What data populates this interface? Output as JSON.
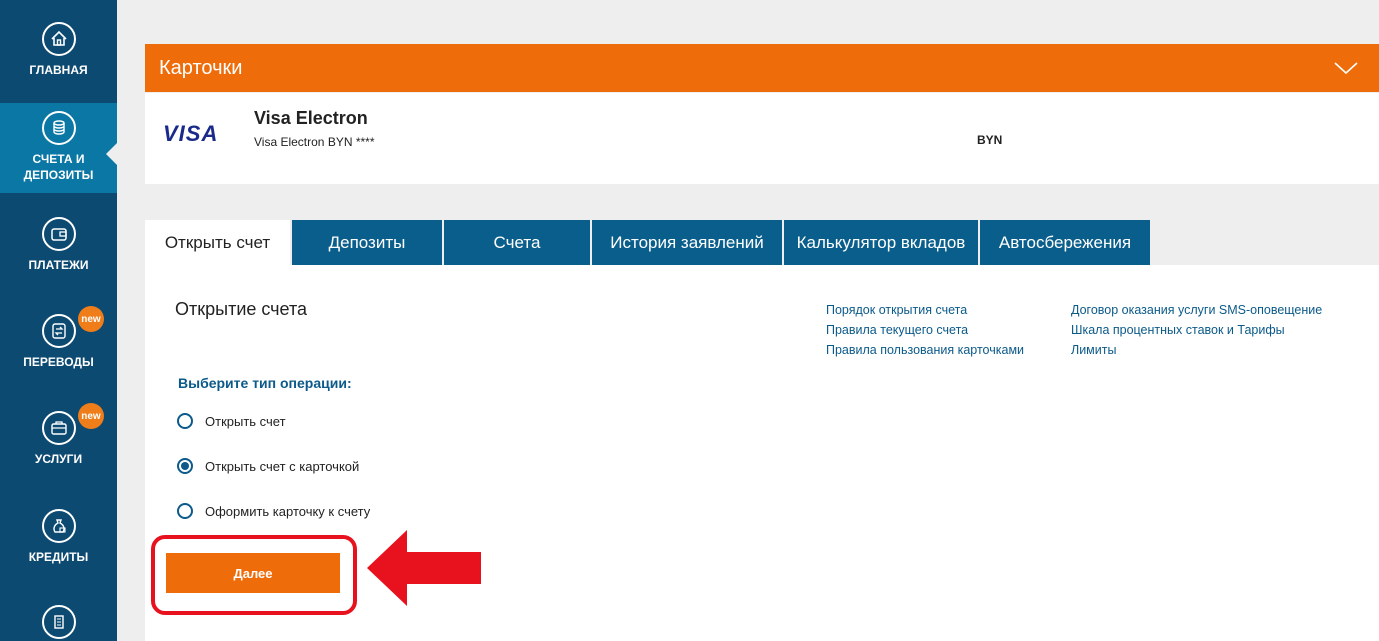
{
  "sidebar": {
    "items": [
      {
        "label": "ГЛАВНАЯ",
        "icon": "home-icon"
      },
      {
        "label": "СЧЕТА И ДЕПОЗИТЫ",
        "icon": "coins-icon"
      },
      {
        "label": "ПЛАТЕЖИ",
        "icon": "wallet-icon"
      },
      {
        "label": "ПЕРЕВОДЫ",
        "icon": "transfer-icon",
        "badge": "new"
      },
      {
        "label": "УСЛУГИ",
        "icon": "briefcase-icon",
        "badge": "new"
      },
      {
        "label": "КРЕДИТЫ",
        "icon": "money-bag-icon"
      },
      {
        "label": "",
        "icon": "document-icon"
      }
    ],
    "badge_color": "#ef7d1a"
  },
  "cards": {
    "header_title": "Карточки",
    "brand": "VISA",
    "card_name": "Visa Electron",
    "card_sub": "Visa Electron BYN ****",
    "currency": "BYN"
  },
  "tabs": [
    "Открыть счет",
    "Депозиты",
    "Счета",
    "История заявлений",
    "Калькулятор вкладов",
    "Автосбережения"
  ],
  "open_account": {
    "title": "Открытие счета",
    "links_col1": [
      "Порядок открытия счета",
      "Правила текущего счета",
      "Правила пользования карточками"
    ],
    "links_col2": [
      "Договор оказания услуги SMS-оповещение",
      "Шкала процентных ставок и Тарифы",
      "Лимиты"
    ],
    "choose_label": "Выберите тип операции:",
    "options": [
      "Открыть счет",
      "Открыть счет с карточкой",
      "Оформить карточку к счету"
    ],
    "selected_option": "Открыть счет с карточкой",
    "next_button": "Далее"
  },
  "colors": {
    "sidebar": "#0d4a72",
    "active_nav": "#0b77a5",
    "accent_orange": "#ef6c0a",
    "tab_blue": "#0a5e8c",
    "highlight_red": "#e8121e"
  }
}
